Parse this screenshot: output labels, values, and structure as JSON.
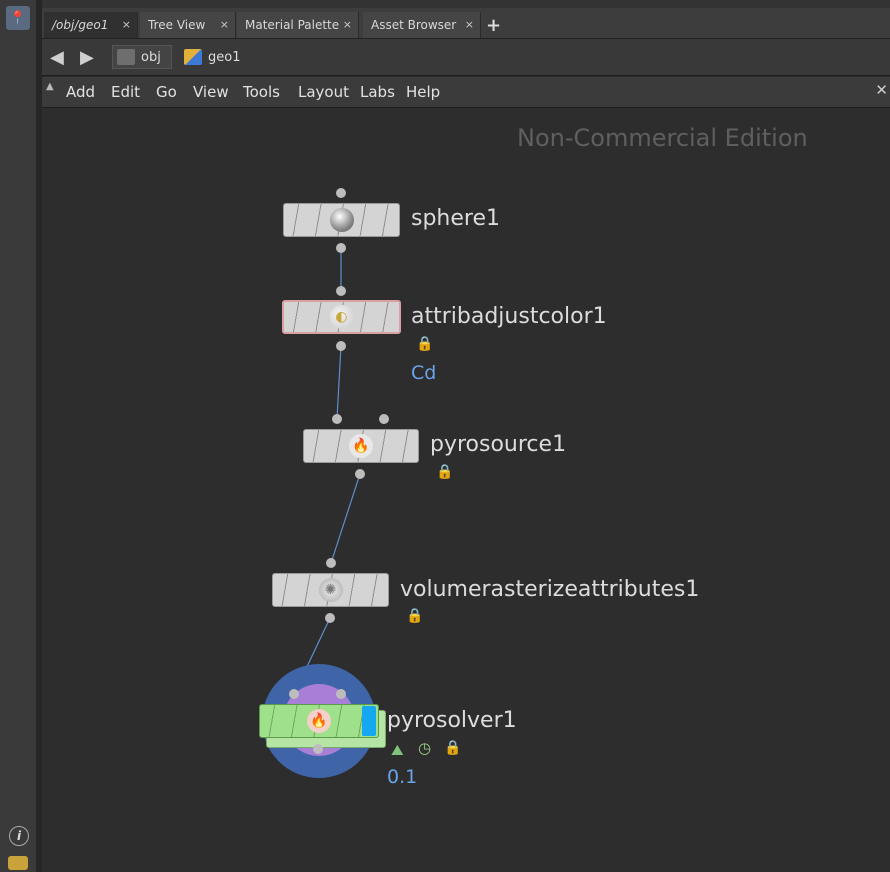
{
  "tabs": [
    {
      "label": "/obj/geo1",
      "active": true
    },
    {
      "label": "Tree View"
    },
    {
      "label": "Material Palette"
    },
    {
      "label": "Asset Browser"
    }
  ],
  "tab_close": "×",
  "add_tab": "+",
  "path": {
    "obj": "obj",
    "geo": "geo1"
  },
  "menu": [
    "Add",
    "Edit",
    "Go",
    "View",
    "Tools",
    "Layout",
    "Labs",
    "Help"
  ],
  "watermark": "Non-Commercial Edition",
  "nodes": {
    "sphere": {
      "name": "sphere1"
    },
    "attrib": {
      "name": "attribadjustcolor1",
      "param": "Cd"
    },
    "pyrosource": {
      "name": "pyrosource1"
    },
    "volraster": {
      "name": "volumerasterizeattributes1"
    },
    "pyrosolver": {
      "name": "pyrosolver1",
      "value": "0.1"
    }
  },
  "icons": {
    "sphere": "sphere-icon",
    "attrib": "color-adjust-icon",
    "pyrosource": "fire-icon",
    "volraster": "volume-icon",
    "pyrosolver": "pyro-solver-icon",
    "lock": "lock-icon",
    "info": "info-icon"
  },
  "colors": {
    "node_body": "#d4d4d4",
    "solver_node": "#9fe08a",
    "accent_blue": "#6aa3e8",
    "ring_blue": "#3f65a8",
    "ring_purple": "#a77fd6"
  }
}
